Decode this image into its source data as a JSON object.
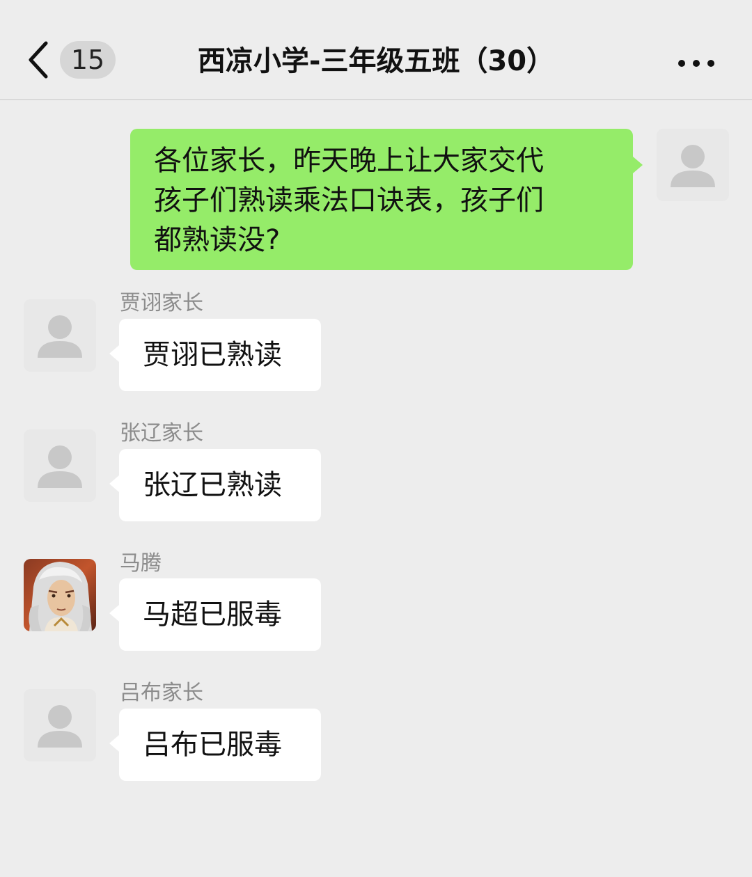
{
  "header": {
    "back_icon": "chevron-left-icon",
    "unread_count": "15",
    "title": "西凉小学-三年级五班（30）",
    "more_icon": "more-dots-icon"
  },
  "messages": [
    {
      "direction": "sent",
      "lines": [
        "各位家长，昨天晚上让大家交代",
        "孩子们熟读乘法口诀表，孩子们",
        "都熟读没?"
      ]
    },
    {
      "direction": "received",
      "sender": "贾诩家长",
      "text": "贾诩已熟读",
      "avatar": "default-avatar-icon"
    },
    {
      "direction": "received",
      "sender": "张辽家长",
      "text": "张辽已熟读",
      "avatar": "default-avatar-icon"
    },
    {
      "direction": "received",
      "sender": "马腾",
      "text": "马超已服毒",
      "avatar": "character-portrait"
    },
    {
      "direction": "received",
      "sender": "吕布家长",
      "text": "吕布已服毒",
      "avatar": "default-avatar-icon"
    }
  ],
  "colors": {
    "background": "#ededed",
    "sent_bubble": "#95ec69",
    "received_bubble": "#ffffff",
    "sender_name": "#8c8c8c"
  }
}
